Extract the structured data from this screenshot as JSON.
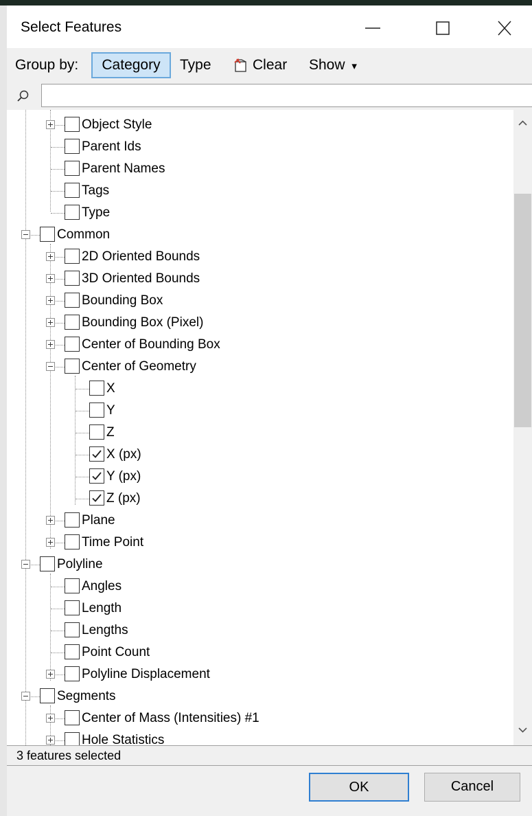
{
  "window": {
    "title": "Select Features",
    "minimize_label": "Minimize",
    "maximize_label": "Maximize",
    "close_label": "Close"
  },
  "toolbar": {
    "group_by_label": "Group by:",
    "category_label": "Category",
    "type_label": "Type",
    "clear_label": "Clear",
    "show_label": "Show",
    "show_caret": "▾"
  },
  "search": {
    "value": "",
    "placeholder": ""
  },
  "tree": {
    "rows": [
      {
        "level": 2,
        "label": "Object Style",
        "expander": "plus",
        "checked": false
      },
      {
        "level": 2,
        "label": "Parent Ids",
        "expander": "none",
        "checked": false
      },
      {
        "level": 2,
        "label": "Parent Names",
        "expander": "none",
        "checked": false
      },
      {
        "level": 2,
        "label": "Tags",
        "expander": "none",
        "checked": false
      },
      {
        "level": 2,
        "label": "Type",
        "expander": "none",
        "checked": false
      },
      {
        "level": 1,
        "label": "Common",
        "expander": "minus",
        "checked": false
      },
      {
        "level": 2,
        "label": "2D Oriented Bounds",
        "expander": "plus",
        "checked": false
      },
      {
        "level": 2,
        "label": "3D Oriented Bounds",
        "expander": "plus",
        "checked": false
      },
      {
        "level": 2,
        "label": "Bounding Box",
        "expander": "plus",
        "checked": false
      },
      {
        "level": 2,
        "label": "Bounding Box (Pixel)",
        "expander": "plus",
        "checked": false
      },
      {
        "level": 2,
        "label": "Center of Bounding Box",
        "expander": "plus",
        "checked": false
      },
      {
        "level": 2,
        "label": "Center of Geometry",
        "expander": "minus",
        "checked": false
      },
      {
        "level": 3,
        "label": "X",
        "expander": "none",
        "checked": false
      },
      {
        "level": 3,
        "label": "Y",
        "expander": "none",
        "checked": false
      },
      {
        "level": 3,
        "label": "Z",
        "expander": "none",
        "checked": false
      },
      {
        "level": 3,
        "label": "X (px)",
        "expander": "none",
        "checked": true
      },
      {
        "level": 3,
        "label": "Y (px)",
        "expander": "none",
        "checked": true
      },
      {
        "level": 3,
        "label": "Z (px)",
        "expander": "none",
        "checked": true
      },
      {
        "level": 2,
        "label": "Plane",
        "expander": "plus",
        "checked": false
      },
      {
        "level": 2,
        "label": "Time Point",
        "expander": "plus",
        "checked": false
      },
      {
        "level": 1,
        "label": "Polyline",
        "expander": "minus",
        "checked": false
      },
      {
        "level": 2,
        "label": "Angles",
        "expander": "none",
        "checked": false
      },
      {
        "level": 2,
        "label": "Length",
        "expander": "none",
        "checked": false
      },
      {
        "level": 2,
        "label": "Lengths",
        "expander": "none",
        "checked": false
      },
      {
        "level": 2,
        "label": "Point Count",
        "expander": "none",
        "checked": false
      },
      {
        "level": 2,
        "label": "Polyline Displacement",
        "expander": "plus",
        "checked": false
      },
      {
        "level": 1,
        "label": "Segments",
        "expander": "minus",
        "checked": false
      },
      {
        "level": 2,
        "label": "Center of Mass (Intensities) #1",
        "expander": "plus",
        "checked": false
      },
      {
        "level": 2,
        "label": "Hole Statistics",
        "expander": "plus",
        "checked": false
      }
    ]
  },
  "status": {
    "text": "3 features selected"
  },
  "buttons": {
    "ok": "OK",
    "cancel": "Cancel"
  },
  "colors": {
    "accent": "#2f7fd1",
    "selected_toggle_bg": "#cde4f7",
    "selected_toggle_border": "#6aa8dc",
    "checkmark": "#1f1f1f"
  }
}
